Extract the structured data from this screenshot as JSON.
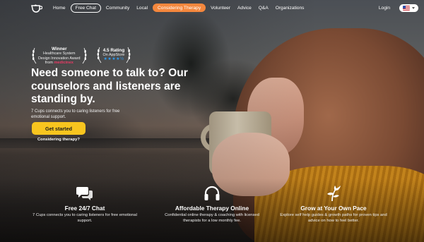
{
  "nav": {
    "links": [
      "Home",
      "Free Chat",
      "Community",
      "Local",
      "Considering Therapy",
      "Volunteer",
      "Advice",
      "Q&A",
      "Organizations"
    ],
    "login": "Login",
    "icons": {
      "logo": "cup-logo-icon",
      "language": "us-flag-icon"
    },
    "accent_color": "#f4873d"
  },
  "awards": {
    "award1": {
      "title": "Winner",
      "line1": "Healthcare System",
      "line2": "Design Innovation Award",
      "brand_prefix": "from ",
      "brand": "medicine",
      "brand_suffix": "x"
    },
    "award2": {
      "title": "4.5 Rating",
      "line1": "On AppStore",
      "stars": "★★★★½"
    }
  },
  "hero": {
    "headline": "Need someone to talk to? Our counselors and listeners are standing by.",
    "subtext": "7 Cups connects you to caring listeners for free emotional support.",
    "cta_label": "Get started",
    "cta_color": "#f8c51f",
    "secondary_link": "Considering therapy?"
  },
  "features": [
    {
      "icon": "chat-bubbles-icon",
      "title": "Free 24/7 Chat",
      "desc": "7 Cups connects you to caring listeners for free emotional support."
    },
    {
      "icon": "headphones-icon",
      "title": "Affordable Therapy Online",
      "desc": "Confidential online therapy & coaching with licensed therapists for a low monthly fee."
    },
    {
      "icon": "plant-growth-icon",
      "title": "Grow at Your Own Pace",
      "desc": "Explore self help guides & growth paths for proven tips and advice on how to feel better."
    }
  ]
}
